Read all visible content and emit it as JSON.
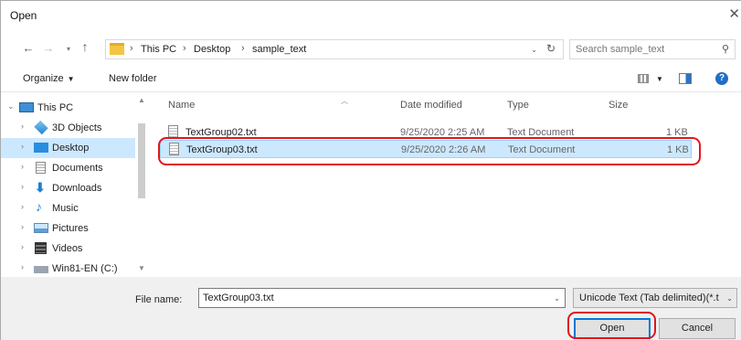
{
  "window": {
    "title": "Open",
    "close_glyph": "✕"
  },
  "address_bar": {
    "crumbs": [
      "This PC",
      "Desktop",
      "sample_text"
    ],
    "separator": "›"
  },
  "search": {
    "placeholder": "Search sample_text"
  },
  "toolbar": {
    "organize_label": "Organize",
    "new_folder_label": "New folder",
    "help_label": "?"
  },
  "nav": {
    "items": [
      {
        "label": "This PC",
        "icon": "monitor-icon"
      },
      {
        "label": "3D Objects",
        "icon": "3d-objects-icon"
      },
      {
        "label": "Desktop",
        "icon": "desktop-icon",
        "selected": true
      },
      {
        "label": "Documents",
        "icon": "documents-icon"
      },
      {
        "label": "Downloads",
        "icon": "downloads-icon"
      },
      {
        "label": "Music",
        "icon": "music-icon"
      },
      {
        "label": "Pictures",
        "icon": "pictures-icon"
      },
      {
        "label": "Videos",
        "icon": "videos-icon"
      },
      {
        "label": "Win81-EN (C:)",
        "icon": "drive-icon"
      }
    ]
  },
  "file_list": {
    "columns": {
      "name": "Name",
      "date": "Date modified",
      "type": "Type",
      "size": "Size"
    },
    "rows": [
      {
        "name": "TextGroup02.txt",
        "date": "9/25/2020 2:25 AM",
        "type": "Text Document",
        "size": "1 KB"
      },
      {
        "name": "TextGroup03.txt",
        "date": "9/25/2020 2:26 AM",
        "type": "Text Document",
        "size": "1 KB",
        "selected": true
      }
    ]
  },
  "footer": {
    "file_name_label": "File name:",
    "file_name_value": "TextGroup03.txt",
    "file_type_value": "Unicode Text (Tab delimited)(*.t",
    "open_label": "Open",
    "cancel_label": "Cancel"
  },
  "colors": {
    "selection": "#cce8ff",
    "highlight_ring": "#e0161c",
    "accent": "#0078d7"
  }
}
